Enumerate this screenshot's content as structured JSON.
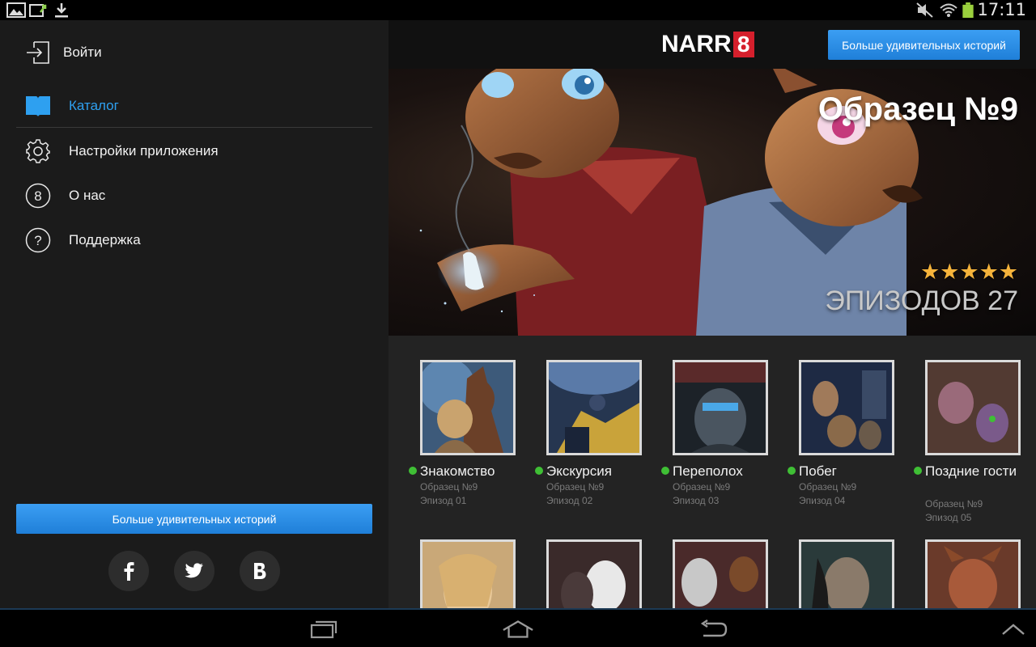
{
  "status_bar": {
    "time": "17:11"
  },
  "drawer": {
    "login_label": "Войти",
    "menu": [
      {
        "label": "Каталог",
        "icon": "book-icon",
        "active": true
      },
      {
        "label": "Настройки приложения",
        "icon": "gear-icon",
        "active": false
      },
      {
        "label": "О нас",
        "icon": "eight-circle-icon",
        "active": false
      },
      {
        "label": "Поддержка",
        "icon": "question-circle-icon",
        "active": false
      }
    ],
    "cta_label": "Больше удивительных историй",
    "social": [
      {
        "icon": "facebook-icon"
      },
      {
        "icon": "twitter-icon"
      },
      {
        "icon": "vk-icon"
      }
    ]
  },
  "header": {
    "logo_text": "NARR",
    "logo_digit": "8",
    "cta_label": "Больше удивительных историй"
  },
  "hero": {
    "title": "Образец №9",
    "stars": "★★★★★",
    "rating": 5,
    "episodes": "ЭПИЗОДОВ 27"
  },
  "episodes": [
    {
      "title": "Знакомство",
      "series": "Образец №9",
      "episode": "Эпизод 01"
    },
    {
      "title": "Экскурсия",
      "series": "Образец №9",
      "episode": "Эпизод 02"
    },
    {
      "title": "Переполох",
      "series": "Образец №9",
      "episode": "Эпизод 03"
    },
    {
      "title": "Побег",
      "series": "Образец №9",
      "episode": "Эпизод 04"
    },
    {
      "title": "Поздние гости",
      "series": "Образец №9",
      "episode": "Эпизод 05"
    }
  ],
  "colors": {
    "accent": "#2ea0f0",
    "brand_red": "#d51f2c",
    "new_dot": "#3fbf35",
    "star": "#f5b33b"
  }
}
